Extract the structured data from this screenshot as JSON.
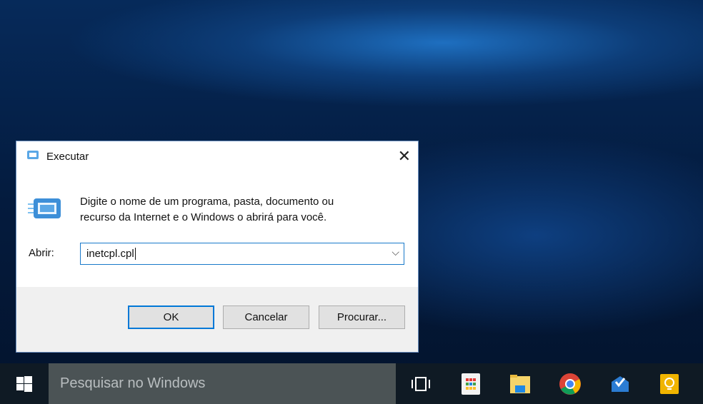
{
  "dialog": {
    "title": "Executar",
    "message_line1": "Digite o nome de um programa, pasta, documento ou",
    "message_line2": "recurso da Internet e o Windows o abrirá para você.",
    "open_label": "Abrir:",
    "input_value": "inetcpl.cpl",
    "ok": "OK",
    "cancel": "Cancelar",
    "browse": "Procurar..."
  },
  "taskbar": {
    "search_placeholder": "Pesquisar no Windows"
  }
}
